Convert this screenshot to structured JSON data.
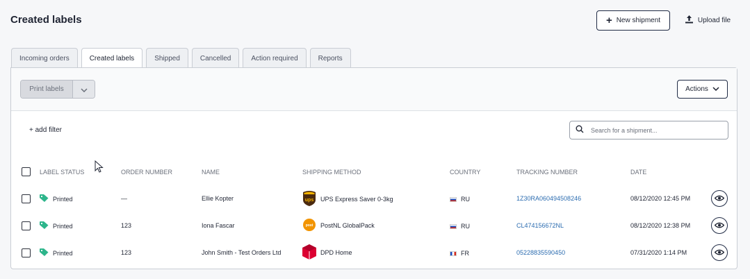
{
  "header": {
    "title": "Created labels",
    "new_shipment_label": "New shipment",
    "upload_file_label": "Upload file"
  },
  "tabs": [
    {
      "label": "Incoming orders"
    },
    {
      "label": "Created labels",
      "active": true
    },
    {
      "label": "Shipped"
    },
    {
      "label": "Cancelled"
    },
    {
      "label": "Action required"
    },
    {
      "label": "Reports"
    }
  ],
  "toolbar": {
    "print_labels_label": "Print labels",
    "actions_label": "Actions"
  },
  "filters": {
    "add_filter_label": "+ add filter",
    "search_placeholder": "Search for a shipment..."
  },
  "table": {
    "columns": [
      "LABEL STATUS",
      "ORDER NUMBER",
      "NAME",
      "SHIPPING METHOD",
      "COUNTRY",
      "TRACKING NUMBER",
      "DATE"
    ],
    "rows": [
      {
        "status": "Printed",
        "order": "—",
        "name": "Ellie Kopter",
        "method": "UPS Express Saver 0-3kg",
        "carrier_icon": "ups-logo-icon",
        "country": "RU",
        "tracking": "1Z30RA060494508246",
        "date": "08/12/2020 12:45 PM"
      },
      {
        "status": "Printed",
        "order": "123",
        "name": "Iona Fascar",
        "method": "PostNL GlobalPack",
        "carrier_icon": "postnl-logo-icon",
        "country": "RU",
        "tracking": "CL474156672NL",
        "date": "08/12/2020 12:38 PM"
      },
      {
        "status": "Printed",
        "order": "123",
        "name": "John Smith - Test Orders Ltd",
        "method": "DPD Home",
        "carrier_icon": "dpd-logo-icon",
        "country": "FR",
        "tracking": "05228835590450",
        "date": "07/31/2020 1:14 PM"
      }
    ]
  },
  "colors": {
    "accent_dark": "#1f2a44",
    "tag_green": "#2db58b",
    "link_blue": "#2b6cb0"
  }
}
